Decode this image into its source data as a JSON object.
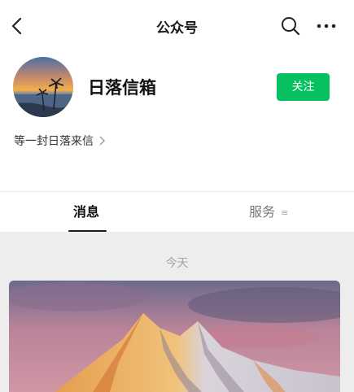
{
  "nav": {
    "title": "公众号",
    "icons": [
      "back-icon",
      "search-icon",
      "more-icon"
    ]
  },
  "profile": {
    "name": "日落信箱",
    "follow_label": "关注",
    "intro": "等一封日落来信",
    "colors": {
      "follow": "#07c160"
    }
  },
  "tabs": [
    {
      "label": "消息",
      "active": true
    },
    {
      "label": "服务",
      "icon": "menu-lines-icon"
    }
  ],
  "feed": {
    "date_label": "今天",
    "article": {
      "image": "mountain-sunset-photo"
    }
  }
}
